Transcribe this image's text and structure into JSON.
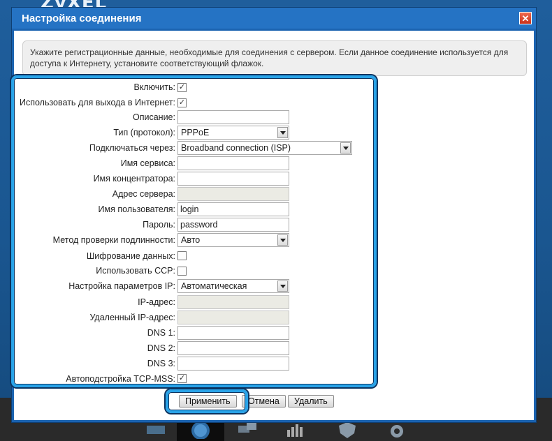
{
  "window": {
    "title": "Настройка соединения",
    "close_glyph": "✕",
    "info": "Укажите регистрационные данные, необходимые для соединения с сервером. Если данное соединение используется для доступа к Интернету, установите соответствующий флажок."
  },
  "background": {
    "logo_text": "ZyXEL"
  },
  "form": {
    "enable": {
      "label": "Включить:",
      "checked": true
    },
    "internet": {
      "label": "Использовать для выхода в Интернет:",
      "checked": true
    },
    "description": {
      "label": "Описание:",
      "value": ""
    },
    "protocol": {
      "label": "Тип (протокол):",
      "value": "PPPoE"
    },
    "connect_via": {
      "label": "Подключаться через:",
      "value": "Broadband connection (ISP)"
    },
    "service_name": {
      "label": "Имя сервиса:",
      "value": ""
    },
    "concentrator": {
      "label": "Имя концентратора:",
      "value": ""
    },
    "server_address": {
      "label": "Адрес сервера:",
      "value": ""
    },
    "username": {
      "label": "Имя пользователя:",
      "value": "login"
    },
    "password": {
      "label": "Пароль:",
      "value": "password"
    },
    "auth_method": {
      "label": "Метод проверки подлинности:",
      "value": "Авто"
    },
    "encryption": {
      "label": "Шифрование данных:",
      "checked": false
    },
    "ccp": {
      "label": "Использовать CCP:",
      "checked": false
    },
    "ip_settings": {
      "label": "Настройка параметров IP:",
      "value": "Автоматическая"
    },
    "ip_address": {
      "label": "IP-адрес:",
      "value": ""
    },
    "remote_ip": {
      "label": "Удаленный IP-адрес:",
      "value": ""
    },
    "dns1": {
      "label": "DNS 1:",
      "value": ""
    },
    "dns2": {
      "label": "DNS 2:",
      "value": ""
    },
    "dns3": {
      "label": "DNS 3:",
      "value": ""
    },
    "tcp_mss": {
      "label": "Автоподстройка TCP-MSS:",
      "checked": true
    }
  },
  "buttons": {
    "apply": "Применить",
    "cancel": "Отмена",
    "delete": "Удалить"
  },
  "checkmark": "✓",
  "colors": {
    "highlight": "#29a3e8",
    "dialog": "#1b63b0"
  }
}
